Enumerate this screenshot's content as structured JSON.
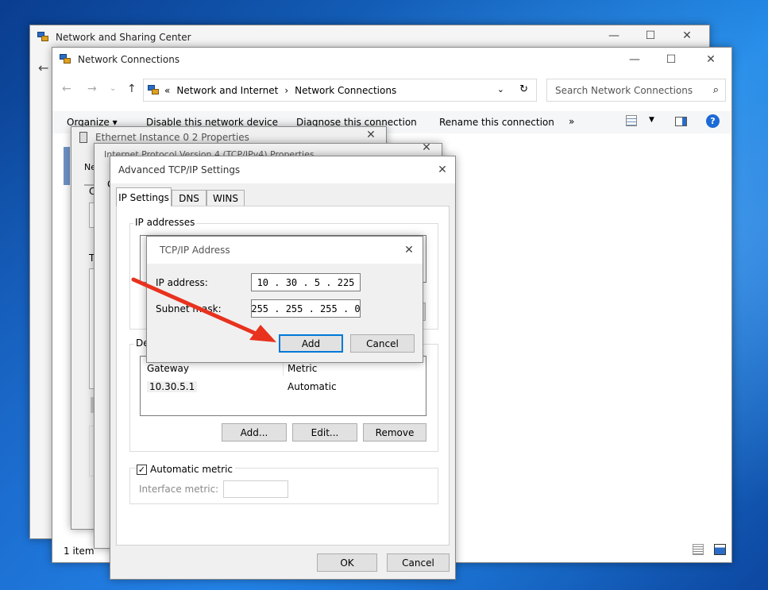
{
  "network_sharing": {
    "title": "Network and Sharing Center"
  },
  "network_connections": {
    "title": "Network Connections",
    "address": {
      "prefix": "«",
      "crumb1": "Network and Internet",
      "sep": "›",
      "crumb2": "Network Connections"
    },
    "search_placeholder": "Search Network Connections",
    "toolbar": {
      "organize": "Organize ▾",
      "disable": "Disable this network device",
      "diagnose": "Diagnose this connection",
      "rename": "Rename this connection",
      "more": "»"
    },
    "status": "1 item"
  },
  "ethernet_props": {
    "title": "Ethernet Instance 0 2 Properties",
    "tab_fragment": "Ne"
  },
  "ipv4_props": {
    "title": "Internet Protocol Version 4 (TCP/IPv4) Properties"
  },
  "advanced": {
    "title": "Advanced TCP/IP Settings",
    "tabs": [
      "IP Settings",
      "DNS",
      "WINS"
    ],
    "ip_group": "IP addresses",
    "gateway_group_fragment": "De",
    "gateway_table": {
      "headers": [
        "Gateway",
        "Metric"
      ],
      "rows": [
        [
          "10.30.5.1",
          "Automatic"
        ]
      ]
    },
    "buttons": {
      "add": "Add...",
      "edit": "Edit...",
      "remove": "Remove"
    },
    "automatic_metric": "Automatic metric",
    "interface_metric": "Interface metric:",
    "ok": "OK",
    "cancel": "Cancel"
  },
  "tcpip_address": {
    "title": "TCP/IP Address",
    "ip_label": "IP address:",
    "ip_value": "10 . 30 . 5 . 225",
    "mask_label": "Subnet mask:",
    "mask_value": "255 . 255 . 255 . 0",
    "add": "Add",
    "cancel": "Cancel"
  },
  "colors": {
    "accent": "#0078d7",
    "arrow": "#e8321e"
  }
}
